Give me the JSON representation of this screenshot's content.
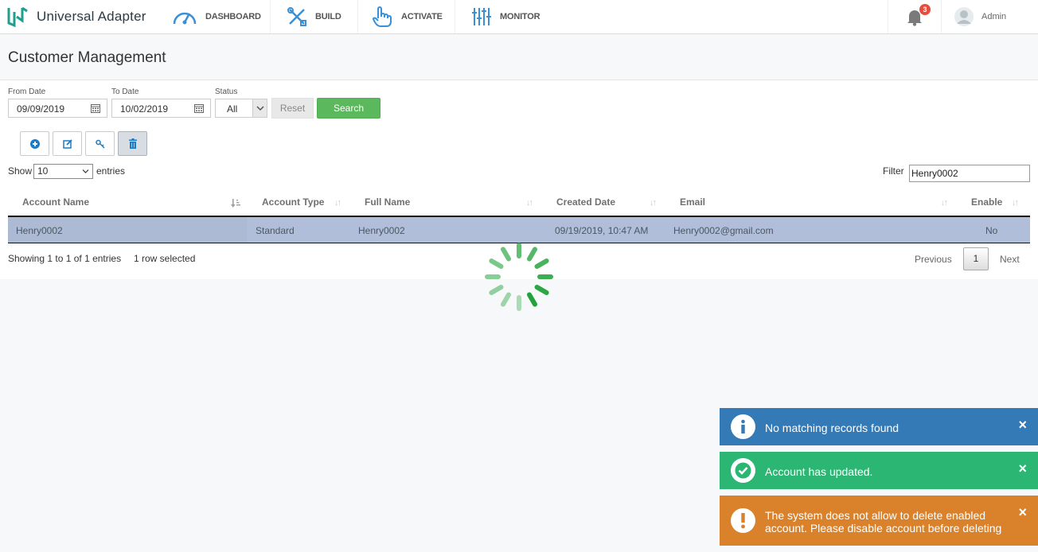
{
  "app": {
    "brand": "Universal Adapter"
  },
  "nav": [
    {
      "label": "DASHBOARD",
      "icon": "gauge-icon"
    },
    {
      "label": "BUILD",
      "icon": "tools-icon"
    },
    {
      "label": "ACTIVATE",
      "icon": "pointer-hand-icon"
    },
    {
      "label": "MONITOR",
      "icon": "sliders-icon"
    }
  ],
  "notifications": {
    "count": "3"
  },
  "user": {
    "name": "Admin"
  },
  "page": {
    "title": "Customer Management"
  },
  "filters": {
    "from_label": "From Date",
    "from_value": "09/09/2019",
    "to_label": "To Date",
    "to_value": "10/02/2019",
    "status_label": "Status",
    "status_value": "All",
    "reset_label": "Reset",
    "search_label": "Search"
  },
  "toolbar": {
    "icons": [
      "add-icon",
      "edit-icon",
      "key-icon",
      "trash-icon"
    ]
  },
  "table_controls": {
    "show_label": "Show",
    "entries_value": "10",
    "entries_label": "entries",
    "filter_label": "Filter",
    "filter_value": "Henry0002"
  },
  "table": {
    "columns": [
      "Account Name",
      "Account Type",
      "Full Name",
      "Created Date",
      "Email",
      "Enable"
    ],
    "rows": [
      [
        "Henry0002",
        "Standard",
        "Henry0002",
        "09/19/2019, 10:47 AM",
        "Henry0002@gmail.com",
        "No"
      ]
    ]
  },
  "footer": {
    "info": "Showing 1 to 1 of 1 entries",
    "selected": "1 row selected",
    "previous": "Previous",
    "current_page": "1",
    "next": "Next"
  },
  "colors": {
    "info": "#337ab7",
    "success": "#2bb673",
    "warning": "#d9822b",
    "selected_row": "#b0bed9",
    "search_button": "#5cb85c",
    "spinner": "#1fa33a"
  },
  "toasts": [
    {
      "type": "info",
      "message": "No matching records found"
    },
    {
      "type": "success",
      "message": "Account has updated."
    },
    {
      "type": "warning",
      "message_line1": "The system does not allow to delete enabled",
      "message_line2": "account. Please disable account before deleting"
    }
  ]
}
